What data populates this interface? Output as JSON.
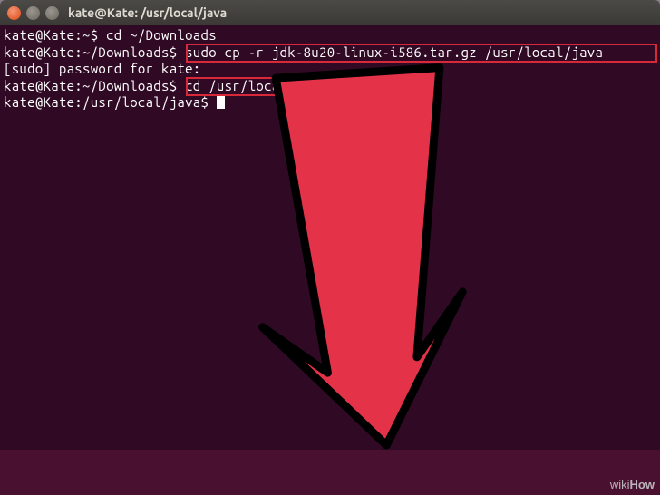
{
  "window": {
    "title": "kate@Kate: /usr/local/java"
  },
  "terminal": {
    "lines": [
      {
        "prompt": "kate@Kate:~$",
        "cmd": " cd ~/Downloads"
      },
      {
        "prompt": "kate@Kate:~/Downloads$",
        "cmd": " sudo cp -r jdk-8u20-linux-i586.tar.gz /usr/local/java"
      },
      {
        "prompt": "[sudo] password for kate:",
        "cmd": ""
      },
      {
        "prompt": "kate@Kate:~/Downloads$",
        "cmd": " cd /usr/local/java"
      },
      {
        "prompt": "kate@Kate:/usr/local/java$",
        "cmd": " "
      }
    ]
  },
  "watermark": {
    "prefix": "wiki",
    "suffix": "How"
  },
  "highlights": {
    "box1_command": "sudo cp -r jdk-8u20-linux-i586.tar.gz /usr/local/java",
    "box2_command": "cd /usr/local/java"
  }
}
